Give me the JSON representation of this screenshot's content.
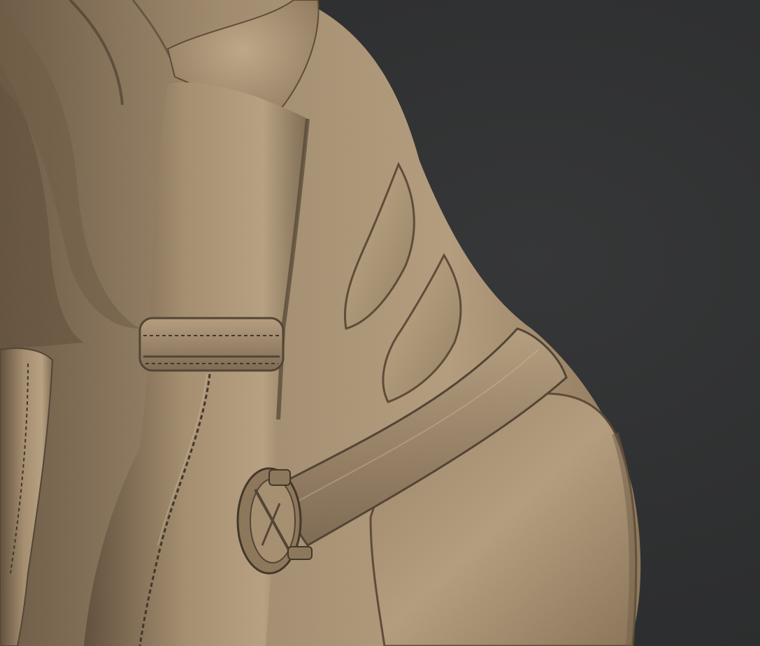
{
  "scene": {
    "background_color": "#2f3031",
    "material_color": "#9c8466",
    "material_highlight": "#c9b192",
    "material_shadow": "#4f4030",
    "stitch_color": "#3e3224"
  },
  "elements": {
    "torso": "leather-torso-sculpt",
    "arm": "sleeved-arm",
    "cuff": "wrist-cuff",
    "belt": "belt-strap",
    "holster": "round-holster",
    "stripes": "embossed-stripes",
    "leg": "thigh-leg",
    "left_arm": "left-sleeve-arm"
  }
}
